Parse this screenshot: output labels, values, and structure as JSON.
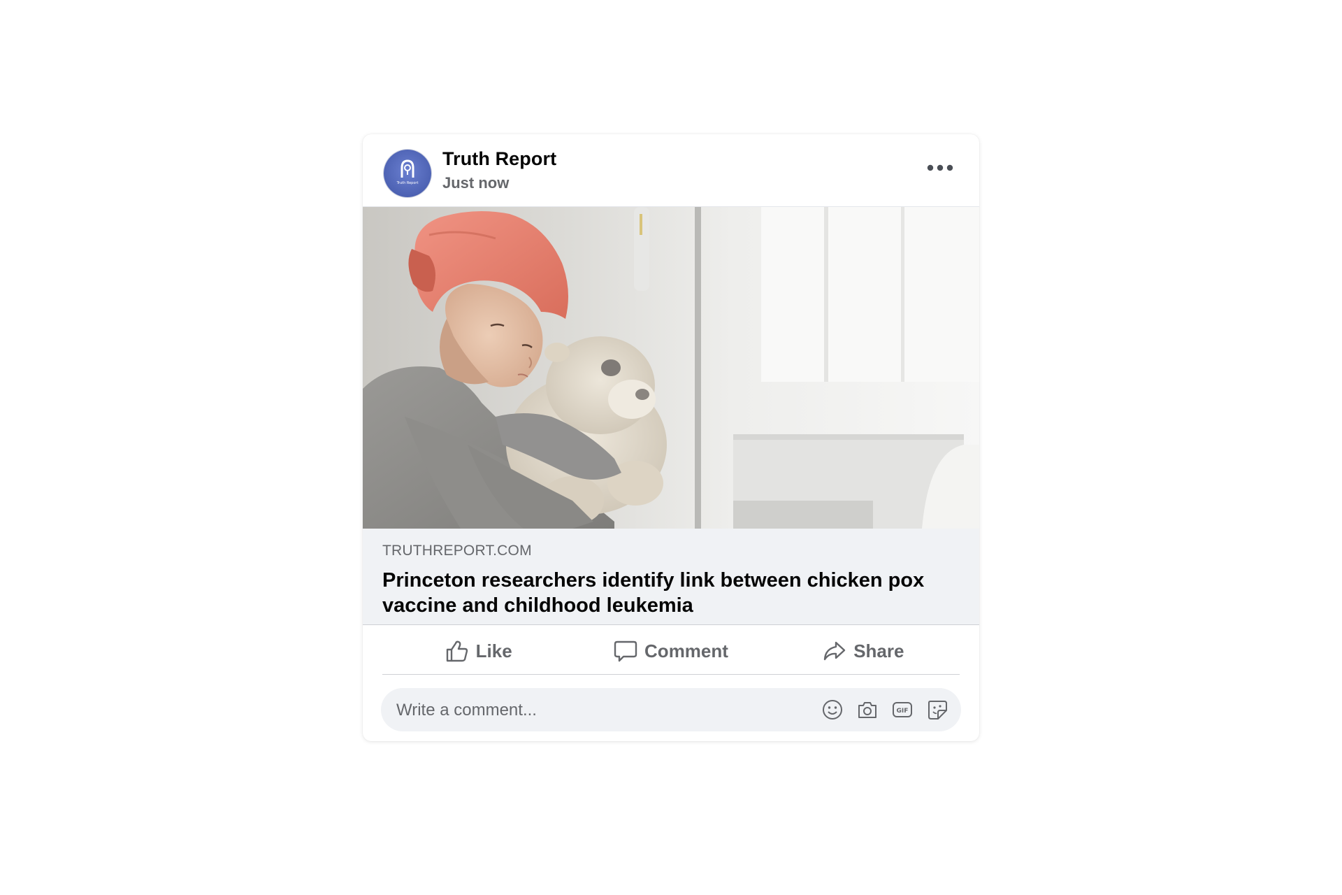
{
  "post": {
    "page_name": "Truth Report",
    "timestamp": "Just now",
    "avatar_text": "Truth Report",
    "link": {
      "domain": "TRUTHREPORT.COM",
      "headline": "Princeton researchers identify link between chicken pox vaccine and childhood leukemia"
    },
    "actions": {
      "like": "Like",
      "comment": "Comment",
      "share": "Share"
    },
    "comment_box": {
      "placeholder": "Write a comment..."
    }
  },
  "colors": {
    "avatar_bg": "#4d62b3",
    "text_primary": "#050505",
    "text_secondary": "#65676b",
    "preview_bg": "#f0f2f5",
    "headscarf": "#e8826f"
  },
  "icons": {
    "more": "more-dots-icon",
    "like": "thumbs-up-icon",
    "comment": "speech-bubble-icon",
    "share": "share-arrow-icon",
    "emoji": "smiley-icon",
    "camera": "camera-icon",
    "gif": "gif-icon",
    "sticker": "sticker-icon"
  }
}
